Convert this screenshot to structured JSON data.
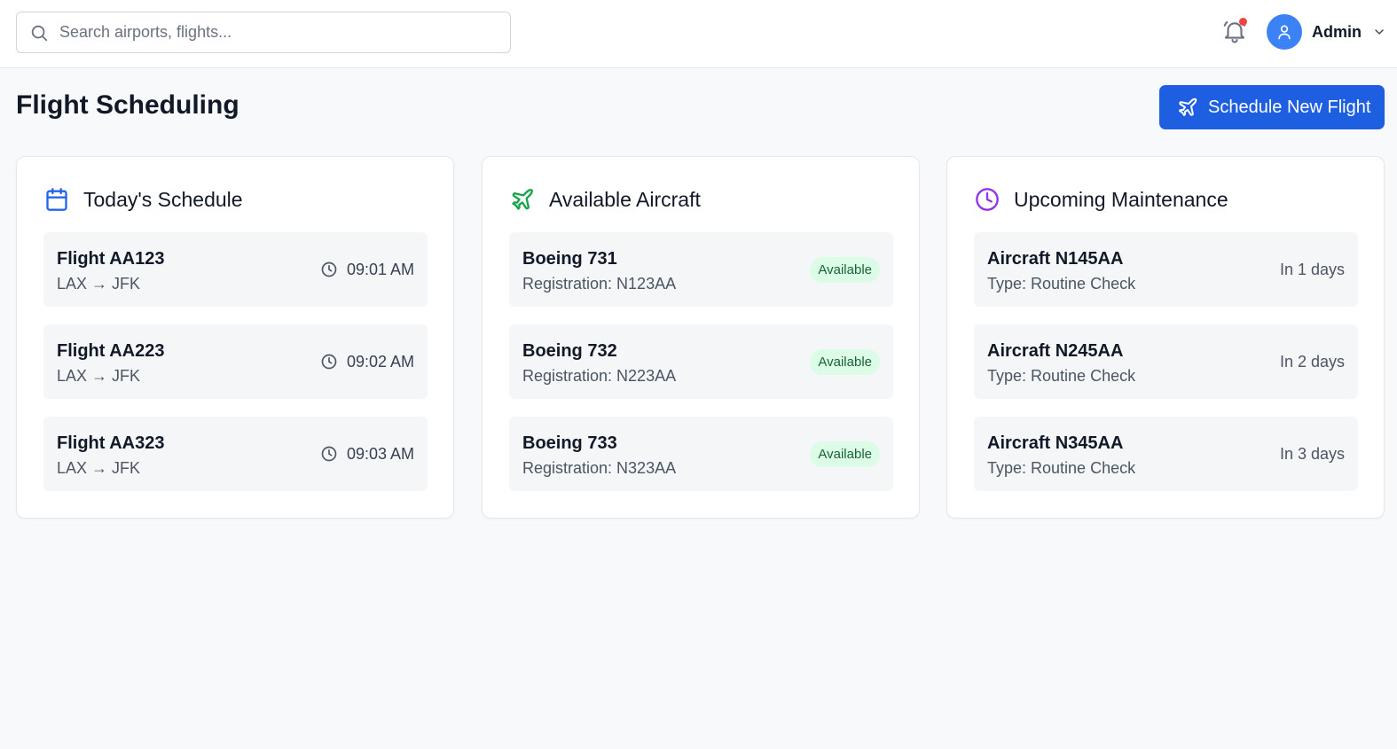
{
  "search": {
    "placeholder": "Search airports, flights..."
  },
  "user": {
    "name": "Admin"
  },
  "page": {
    "title": "Flight Scheduling",
    "primary_button": "Schedule New Flight"
  },
  "colors": {
    "accent": "#1d5fe0",
    "notification_dot": "#ef4444",
    "schedule_icon": "#2563eb",
    "aircraft_icon": "#16a34a",
    "maintenance_icon": "#9333ea",
    "badge_bg": "#dcfce7",
    "badge_text": "#166534"
  },
  "icons": {
    "search": "search-icon",
    "bell": "bell-icon",
    "user": "user-icon",
    "chevron": "chevron-down-icon",
    "plane": "plane-icon",
    "calendar": "calendar-icon",
    "clock": "clock-icon"
  },
  "schedule": {
    "title": "Today's Schedule",
    "items": [
      {
        "flight": "Flight AA123",
        "route": "LAX → JFK",
        "time": "09:01 AM"
      },
      {
        "flight": "Flight AA223",
        "route": "LAX → JFK",
        "time": "09:02 AM"
      },
      {
        "flight": "Flight AA323",
        "route": "LAX → JFK",
        "time": "09:03 AM"
      }
    ]
  },
  "aircraft": {
    "title": "Available Aircraft",
    "items": [
      {
        "model": "Boeing 731",
        "registration": "Registration: N123AA",
        "status": "Available"
      },
      {
        "model": "Boeing 732",
        "registration": "Registration: N223AA",
        "status": "Available"
      },
      {
        "model": "Boeing 733",
        "registration": "Registration: N323AA",
        "status": "Available"
      }
    ]
  },
  "maintenance": {
    "title": "Upcoming Maintenance",
    "items": [
      {
        "aircraft": "Aircraft N145AA",
        "type": "Type: Routine Check",
        "due": "In 1 days"
      },
      {
        "aircraft": "Aircraft N245AA",
        "type": "Type: Routine Check",
        "due": "In 2 days"
      },
      {
        "aircraft": "Aircraft N345AA",
        "type": "Type: Routine Check",
        "due": "In 3 days"
      }
    ]
  }
}
